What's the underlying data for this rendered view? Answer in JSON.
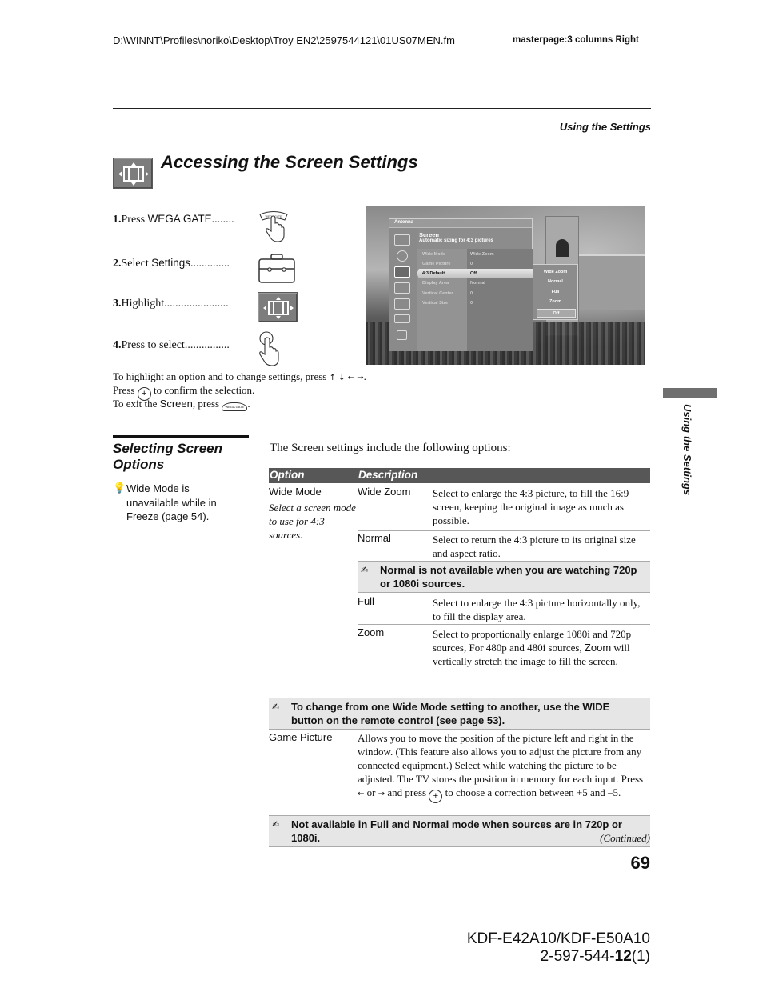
{
  "header": {
    "file_path": "D:\\WINNT\\Profiles\\noriko\\Desktop\\Troy EN2\\2597544121\\01US07MEN.fm",
    "masterpage": "masterpage:3 columns Right",
    "running_head": "Using the Settings"
  },
  "section": {
    "title": "Accessing the Screen Settings",
    "icon": "screen-settings-icon"
  },
  "steps": [
    {
      "num": "1.",
      "pre": "Press ",
      "key": "WEGA GATE",
      "dots": "........",
      "icon": "wega-gate-press-icon"
    },
    {
      "num": "2.",
      "pre": "Select ",
      "key": "Settings",
      "dots": "..............",
      "icon": "settings-toolbox-icon"
    },
    {
      "num": "3.",
      "pre": "Highlight",
      "key": "",
      "dots": ".......................",
      "icon": "screen-settings-icon"
    },
    {
      "num": "4.",
      "pre": "Press to select",
      "key": "",
      "dots": "................",
      "icon": "enter-press-icon"
    }
  ],
  "tv_menu": {
    "source": "Antenna",
    "title": "Screen",
    "subtitle": "Automatic sizing for 4:3 pictures",
    "rows": [
      {
        "label": "Wide Mode",
        "value": "Wide Zoom"
      },
      {
        "label": "Game Picture",
        "value": "0"
      },
      {
        "label": "4:3 Default",
        "value": "Off",
        "highlighted": true
      },
      {
        "label": "Display Area",
        "value": "Normal"
      },
      {
        "label": "Vertical Center",
        "value": "0"
      },
      {
        "label": "Vertical Size",
        "value": "0"
      }
    ],
    "popup_options": [
      "Wide Zoom",
      "Normal",
      "Full",
      "Zoom",
      "Off"
    ],
    "popup_selected": "Off",
    "sidebar_icons": [
      "picture-icon",
      "sound-icon",
      "screen-icon",
      "channel-icon",
      "parent-lock-icon",
      "setup-icon",
      "applications-icon"
    ]
  },
  "instructions": {
    "line1": "To highlight an option and to change settings, press",
    "arrows": "↑ ↓ ← →",
    "line2_pre": "Press",
    "line2_post": "to confirm the selection.",
    "line3_pre": "To exit the ",
    "line3_key": "Screen",
    "line3_mid": ", press",
    "line3_end": "."
  },
  "side_tab": "Using the Settings",
  "subsection": {
    "title": "Selecting Screen Options",
    "tip": "Wide Mode is unavailable while in Freeze (page 54)."
  },
  "intro": "The Screen settings include the following options:",
  "table": {
    "headers": [
      "Option",
      "Description"
    ],
    "wide_mode": {
      "option": "Wide Mode",
      "note": "Select a screen mode to use for 4:3 sources.",
      "subs": [
        {
          "label": "Wide Zoom",
          "desc": "Select to enlarge the 4:3 picture, to fill the 16:9 screen, keeping the original image as much as possible."
        },
        {
          "label": "Normal",
          "desc": "Select to return the 4:3 picture to its original size and aspect ratio."
        },
        {
          "label": "Full",
          "desc": "Select to enlarge the 4:3 picture horizontally only, to fill the display area."
        },
        {
          "label": "Zoom",
          "desc_pre": "Select to proportionally enlarge 1080i and 720p sources, For 480p and 480i sources, ",
          "desc_key": "Zoom",
          "desc_post": " will vertically stretch the image to fill the screen."
        }
      ],
      "normal_note": "Normal is not available when you are watching 720p or 1080i sources.",
      "wide_note": "To change from one Wide Mode setting to another, use the WIDE button on the remote control (see page 53)."
    },
    "game_picture": {
      "option": "Game Picture",
      "desc_pre": "Allows you to move the position of the picture left and right in the window. (This feature also allows you to adjust the picture from any connected equipment.) Select while watching the picture to be adjusted. The TV stores the position in memory for each input. Press ",
      "desc_left": "←",
      "desc_or": " or ",
      "desc_right": "→",
      "desc_mid": " and press ",
      "desc_post": " to choose a correction between +5 and –5.",
      "note": "Not available in Full and Normal mode when sources are in 720p or 1080i."
    }
  },
  "footer": {
    "continued": "(Continued)",
    "page_number": "69",
    "model_line1": "KDF-E42A10/KDF-E50A10",
    "model_line2_pre": "2-597-544-",
    "model_line2_bold": "12",
    "model_line2_post": "(1)"
  },
  "colors": {
    "table_header_bg": "#575757",
    "note_bg": "#e6e6e6",
    "icon_gray": "#7d7d7d",
    "side_tab": "#6f6f6f"
  }
}
